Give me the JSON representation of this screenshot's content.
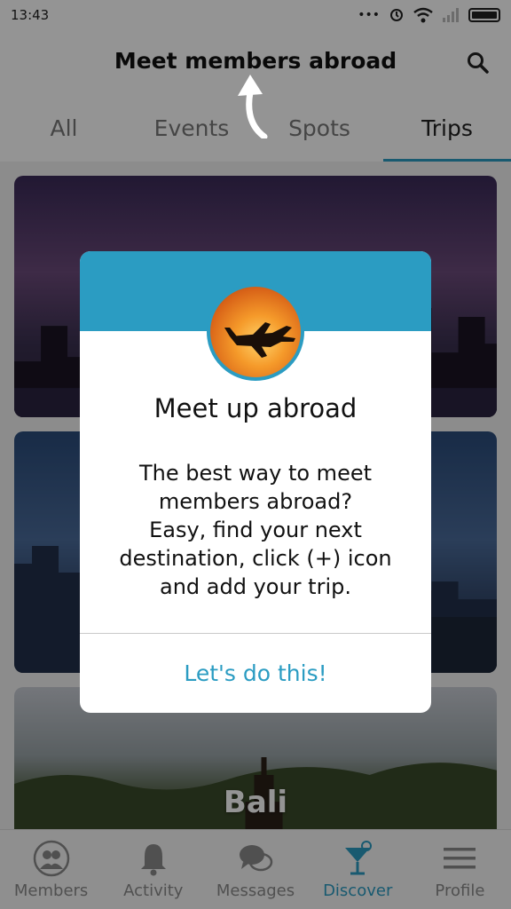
{
  "status_bar": {
    "time": "13:43",
    "dots": "•••"
  },
  "header": {
    "title": "Meet members abroad"
  },
  "tabs": [
    {
      "label": "All"
    },
    {
      "label": "Events"
    },
    {
      "label": "Spots"
    },
    {
      "label": "Trips"
    }
  ],
  "active_tab": "Trips",
  "cards": [
    {
      "label": ""
    },
    {
      "label": ""
    },
    {
      "label": "Bali"
    }
  ],
  "bottom_nav": [
    {
      "label": "Members",
      "icon": "members-icon"
    },
    {
      "label": "Activity",
      "icon": "bell-icon"
    },
    {
      "label": "Messages",
      "icon": "chat-icon"
    },
    {
      "label": "Discover",
      "icon": "cocktail-icon"
    },
    {
      "label": "Profile",
      "icon": "menu-icon"
    }
  ],
  "active_nav": "Discover",
  "modal": {
    "title": "Meet up abroad",
    "body": "The best way to meet\nmembers abroad?\nEasy, find your next\ndestination, click (+) icon\nand add your trip.",
    "action": "Let's do this!",
    "image_icon": "airplane-sunset-icon"
  },
  "colors": {
    "accent": "#2b9cc2",
    "overlay": "rgba(0,0,0,0.42)"
  }
}
